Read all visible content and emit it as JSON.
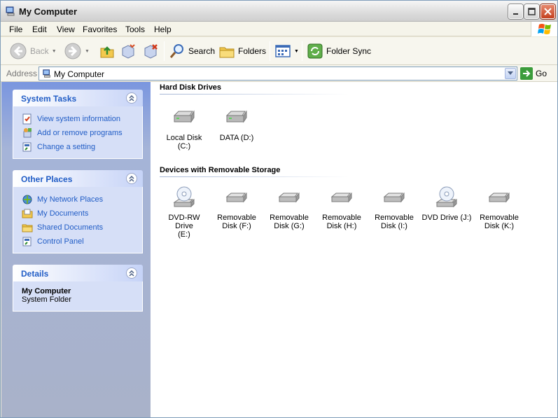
{
  "window": {
    "title": "My Computer"
  },
  "menu": [
    "File",
    "Edit",
    "View",
    "Favorites",
    "Tools",
    "Help"
  ],
  "toolbar": {
    "back": "Back",
    "search": "Search",
    "folders": "Folders",
    "folder_sync": "Folder Sync"
  },
  "address": {
    "label": "Address",
    "value": "My Computer",
    "go": "Go"
  },
  "tasks": {
    "system_tasks": {
      "title": "System Tasks",
      "items": [
        "View system information",
        "Add or remove programs",
        "Change a setting"
      ]
    },
    "other_places": {
      "title": "Other Places",
      "items": [
        "My Network Places",
        "My Documents",
        "Shared Documents",
        "Control Panel"
      ]
    },
    "details": {
      "title": "Details",
      "name": "My Computer",
      "sub": "System Folder"
    }
  },
  "groups": {
    "hard_disks": {
      "title": "Hard Disk Drives",
      "items": [
        "Local Disk (C:)",
        "DATA (D:)"
      ]
    },
    "removable": {
      "title": "Devices with Removable Storage",
      "items": [
        {
          "l1": "DVD-RW Drive",
          "l2": "(E:)",
          "icon": "dvd-drive-icon"
        },
        {
          "l1": "Removable",
          "l2": "Disk (F:)",
          "icon": "removable-disk-icon"
        },
        {
          "l1": "Removable",
          "l2": "Disk (G:)",
          "icon": "removable-disk-icon"
        },
        {
          "l1": "Removable",
          "l2": "Disk (H:)",
          "icon": "removable-disk-icon"
        },
        {
          "l1": "Removable",
          "l2": "Disk (I:)",
          "icon": "removable-disk-icon"
        },
        {
          "l1": "DVD Drive (J:)",
          "l2": "",
          "icon": "dvd-drive-icon"
        },
        {
          "l1": "Removable",
          "l2": "Disk (K:)",
          "icon": "removable-disk-icon"
        }
      ]
    }
  },
  "colors": {
    "link": "#215dc6",
    "task_bg": "#d6dff7",
    "pane_gradient": "#7a96df"
  }
}
